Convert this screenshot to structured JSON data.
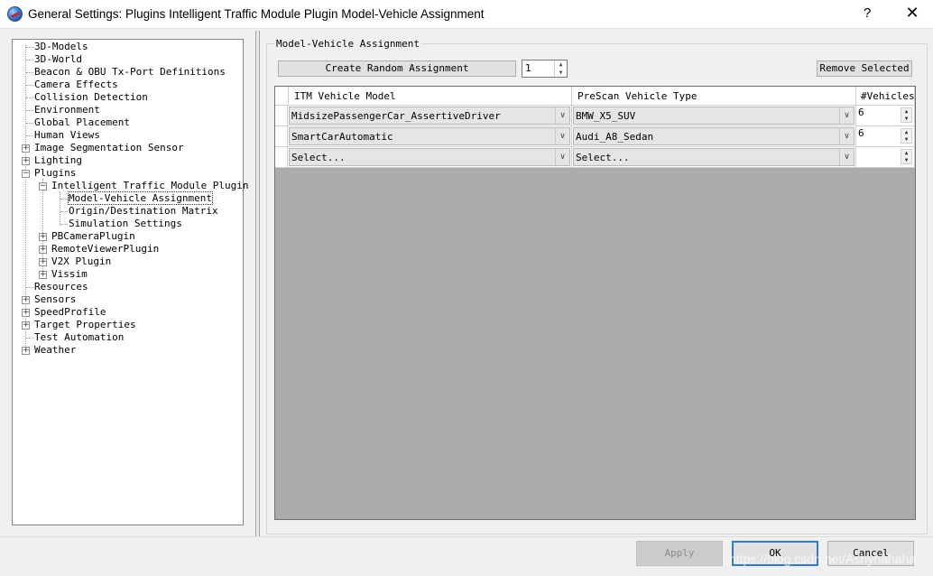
{
  "window": {
    "title": "General Settings: Plugins Intelligent Traffic Module Plugin Model-Vehicle Assignment",
    "help_label": "?",
    "close_label": "✕"
  },
  "tree": {
    "items": [
      {
        "label": "3D-Models"
      },
      {
        "label": "3D-World"
      },
      {
        "label": "Beacon & OBU Tx-Port Definitions"
      },
      {
        "label": "Camera Effects"
      },
      {
        "label": "Collision Detection"
      },
      {
        "label": "Environment"
      },
      {
        "label": "Global Placement"
      },
      {
        "label": "Human Views"
      },
      {
        "label": "Image Segmentation Sensor"
      },
      {
        "label": "Lighting"
      },
      {
        "label": "Plugins"
      },
      {
        "label": "Intelligent Traffic Module Plugin"
      },
      {
        "label": "Model-Vehicle Assignment"
      },
      {
        "label": "Origin/Destination Matrix"
      },
      {
        "label": "Simulation Settings"
      },
      {
        "label": "PBCameraPlugin"
      },
      {
        "label": "RemoteViewerPlugin"
      },
      {
        "label": "V2X Plugin"
      },
      {
        "label": "Vissim"
      },
      {
        "label": "Resources"
      },
      {
        "label": "Sensors"
      },
      {
        "label": "SpeedProfile"
      },
      {
        "label": "Target Properties"
      },
      {
        "label": "Test Automation"
      },
      {
        "label": "Weather"
      }
    ],
    "expander_plus": "+",
    "expander_minus": "−"
  },
  "assignment": {
    "group_title": "Model-Vehicle Assignment",
    "create_random_label": "Create Random Assignment",
    "random_count": "1",
    "remove_selected_label": "Remove Selected",
    "columns": [
      "ITM Vehicle Model",
      "PreScan Vehicle Type",
      "#Vehicles"
    ],
    "rows": [
      {
        "model": "MidsizePassengerCar_AssertiveDriver",
        "type": "BMW_X5_SUV",
        "count": "6"
      },
      {
        "model": "SmartCarAutomatic",
        "type": "Audi_A8_Sedan",
        "count": "6"
      },
      {
        "model": "Select...",
        "type": "Select...",
        "count": ""
      }
    ],
    "dropdown_arrow": "∨",
    "spin_up": "▲",
    "spin_down": "▼"
  },
  "footer": {
    "apply_label": "Apply",
    "ok_label": "OK",
    "cancel_label": "Cancel"
  },
  "watermark": "https://blog.csdn.net/Ashyhahaha",
  "colors": {
    "grid_background": "#ababab",
    "ok_border": "#2f7ad8"
  }
}
